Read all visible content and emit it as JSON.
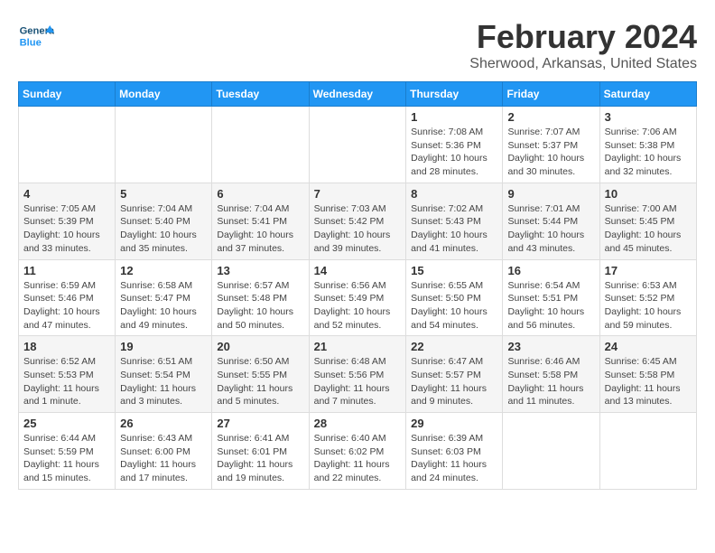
{
  "logo": {
    "general": "General",
    "blue": "Blue"
  },
  "title": "February 2024",
  "subtitle": "Sherwood, Arkansas, United States",
  "days_of_week": [
    "Sunday",
    "Monday",
    "Tuesday",
    "Wednesday",
    "Thursday",
    "Friday",
    "Saturday"
  ],
  "weeks": [
    [
      {
        "day": "",
        "info": ""
      },
      {
        "day": "",
        "info": ""
      },
      {
        "day": "",
        "info": ""
      },
      {
        "day": "",
        "info": ""
      },
      {
        "day": "1",
        "info": "Sunrise: 7:08 AM\nSunset: 5:36 PM\nDaylight: 10 hours and 28 minutes."
      },
      {
        "day": "2",
        "info": "Sunrise: 7:07 AM\nSunset: 5:37 PM\nDaylight: 10 hours and 30 minutes."
      },
      {
        "day": "3",
        "info": "Sunrise: 7:06 AM\nSunset: 5:38 PM\nDaylight: 10 hours and 32 minutes."
      }
    ],
    [
      {
        "day": "4",
        "info": "Sunrise: 7:05 AM\nSunset: 5:39 PM\nDaylight: 10 hours and 33 minutes."
      },
      {
        "day": "5",
        "info": "Sunrise: 7:04 AM\nSunset: 5:40 PM\nDaylight: 10 hours and 35 minutes."
      },
      {
        "day": "6",
        "info": "Sunrise: 7:04 AM\nSunset: 5:41 PM\nDaylight: 10 hours and 37 minutes."
      },
      {
        "day": "7",
        "info": "Sunrise: 7:03 AM\nSunset: 5:42 PM\nDaylight: 10 hours and 39 minutes."
      },
      {
        "day": "8",
        "info": "Sunrise: 7:02 AM\nSunset: 5:43 PM\nDaylight: 10 hours and 41 minutes."
      },
      {
        "day": "9",
        "info": "Sunrise: 7:01 AM\nSunset: 5:44 PM\nDaylight: 10 hours and 43 minutes."
      },
      {
        "day": "10",
        "info": "Sunrise: 7:00 AM\nSunset: 5:45 PM\nDaylight: 10 hours and 45 minutes."
      }
    ],
    [
      {
        "day": "11",
        "info": "Sunrise: 6:59 AM\nSunset: 5:46 PM\nDaylight: 10 hours and 47 minutes."
      },
      {
        "day": "12",
        "info": "Sunrise: 6:58 AM\nSunset: 5:47 PM\nDaylight: 10 hours and 49 minutes."
      },
      {
        "day": "13",
        "info": "Sunrise: 6:57 AM\nSunset: 5:48 PM\nDaylight: 10 hours and 50 minutes."
      },
      {
        "day": "14",
        "info": "Sunrise: 6:56 AM\nSunset: 5:49 PM\nDaylight: 10 hours and 52 minutes."
      },
      {
        "day": "15",
        "info": "Sunrise: 6:55 AM\nSunset: 5:50 PM\nDaylight: 10 hours and 54 minutes."
      },
      {
        "day": "16",
        "info": "Sunrise: 6:54 AM\nSunset: 5:51 PM\nDaylight: 10 hours and 56 minutes."
      },
      {
        "day": "17",
        "info": "Sunrise: 6:53 AM\nSunset: 5:52 PM\nDaylight: 10 hours and 59 minutes."
      }
    ],
    [
      {
        "day": "18",
        "info": "Sunrise: 6:52 AM\nSunset: 5:53 PM\nDaylight: 11 hours and 1 minute."
      },
      {
        "day": "19",
        "info": "Sunrise: 6:51 AM\nSunset: 5:54 PM\nDaylight: 11 hours and 3 minutes."
      },
      {
        "day": "20",
        "info": "Sunrise: 6:50 AM\nSunset: 5:55 PM\nDaylight: 11 hours and 5 minutes."
      },
      {
        "day": "21",
        "info": "Sunrise: 6:48 AM\nSunset: 5:56 PM\nDaylight: 11 hours and 7 minutes."
      },
      {
        "day": "22",
        "info": "Sunrise: 6:47 AM\nSunset: 5:57 PM\nDaylight: 11 hours and 9 minutes."
      },
      {
        "day": "23",
        "info": "Sunrise: 6:46 AM\nSunset: 5:58 PM\nDaylight: 11 hours and 11 minutes."
      },
      {
        "day": "24",
        "info": "Sunrise: 6:45 AM\nSunset: 5:58 PM\nDaylight: 11 hours and 13 minutes."
      }
    ],
    [
      {
        "day": "25",
        "info": "Sunrise: 6:44 AM\nSunset: 5:59 PM\nDaylight: 11 hours and 15 minutes."
      },
      {
        "day": "26",
        "info": "Sunrise: 6:43 AM\nSunset: 6:00 PM\nDaylight: 11 hours and 17 minutes."
      },
      {
        "day": "27",
        "info": "Sunrise: 6:41 AM\nSunset: 6:01 PM\nDaylight: 11 hours and 19 minutes."
      },
      {
        "day": "28",
        "info": "Sunrise: 6:40 AM\nSunset: 6:02 PM\nDaylight: 11 hours and 22 minutes."
      },
      {
        "day": "29",
        "info": "Sunrise: 6:39 AM\nSunset: 6:03 PM\nDaylight: 11 hours and 24 minutes."
      },
      {
        "day": "",
        "info": ""
      },
      {
        "day": "",
        "info": ""
      }
    ]
  ]
}
